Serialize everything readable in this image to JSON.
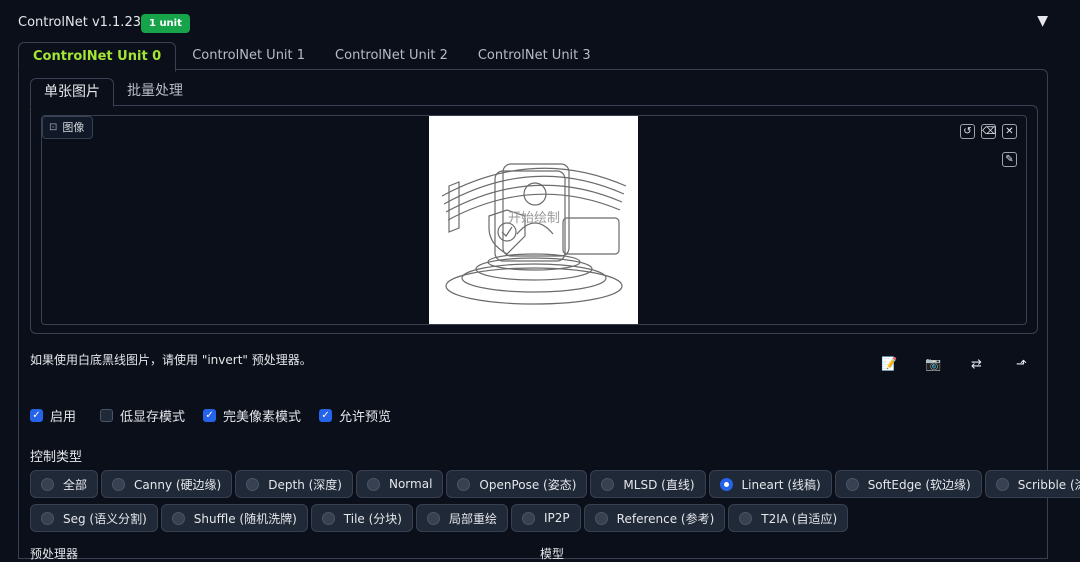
{
  "header": {
    "title": "ControlNet v1.1.237",
    "badge": "1 unit",
    "collapse_glyph": "▼"
  },
  "unit_tabs": [
    "ControlNet Unit 0",
    "ControlNet Unit 1",
    "ControlNet Unit 2",
    "ControlNet Unit 3"
  ],
  "image_tabs": [
    "单张图片",
    "批量处理"
  ],
  "image_panel": {
    "label": "图像",
    "label_icon": "image-icon",
    "watermark_text": "开始绘制",
    "tools": [
      "undo-icon",
      "eraser-icon",
      "close-icon",
      "brush-icon"
    ]
  },
  "hint": "如果使用白底黑线图片，请使用 \"invert\" 预处理器。",
  "action_icons": [
    "edit-icon",
    "camera-icon",
    "swap-icon",
    "send-up-icon"
  ],
  "checkboxes": [
    {
      "label": "启用",
      "checked": true
    },
    {
      "label": "低显存模式",
      "checked": false
    },
    {
      "label": "完美像素模式",
      "checked": true
    },
    {
      "label": "允许预览",
      "checked": true
    }
  ],
  "control_type": {
    "label": "控制类型",
    "selected": "Lineart (线稿)",
    "row1": [
      "全部",
      "Canny (硬边缘)",
      "Depth (深度)",
      "Normal",
      "OpenPose (姿态)",
      "MLSD (直线)",
      "Lineart (线稿)",
      "SoftEdge (软边缘)",
      "Scribble (涂鸦)"
    ],
    "row2": [
      "Seg (语义分割)",
      "Shuffle (随机洗牌)",
      "Tile (分块)",
      "局部重绘",
      "IP2P",
      "Reference (参考)",
      "T2IA (自适应)"
    ]
  },
  "bottom_labels": [
    "预处理器",
    "模型"
  ],
  "colors": {
    "background": "#0b0f19",
    "accent_tab": "#a3e635",
    "badge": "#16a34a",
    "checkbox": "#2563eb"
  }
}
